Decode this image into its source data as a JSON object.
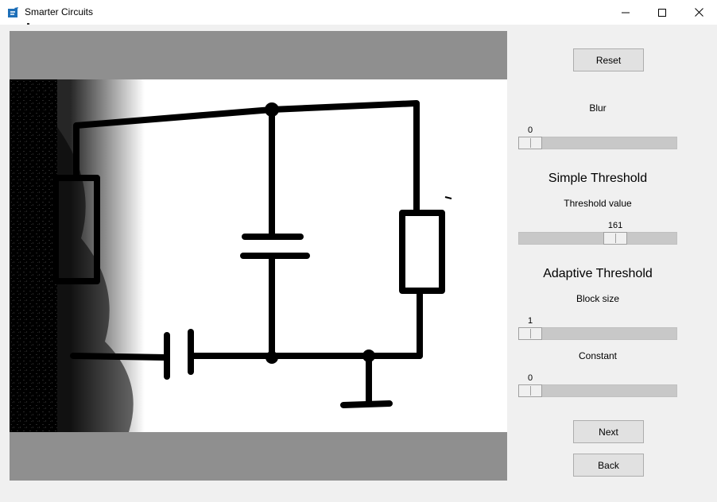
{
  "window": {
    "title": "Smarter Circuits"
  },
  "controls": {
    "reset_label": "Reset",
    "next_label": "Next",
    "back_label": "Back",
    "blur": {
      "label": "Blur",
      "value": "0",
      "fraction": 0.0
    },
    "simple_threshold": {
      "heading": "Simple Threshold",
      "label": "Threshold value",
      "value": "161",
      "fraction": 0.63
    },
    "adaptive_threshold": {
      "heading": "Adaptive Threshold",
      "block_size": {
        "label": "Block size",
        "value": "1",
        "fraction": 0.0
      },
      "constant": {
        "label": "Constant",
        "value": "0",
        "fraction": 0.0
      }
    }
  },
  "colors": {
    "canvas_bg": "#8f8f8f",
    "trough": "#c8c8c8",
    "window_bg": "#f0f0f0"
  }
}
